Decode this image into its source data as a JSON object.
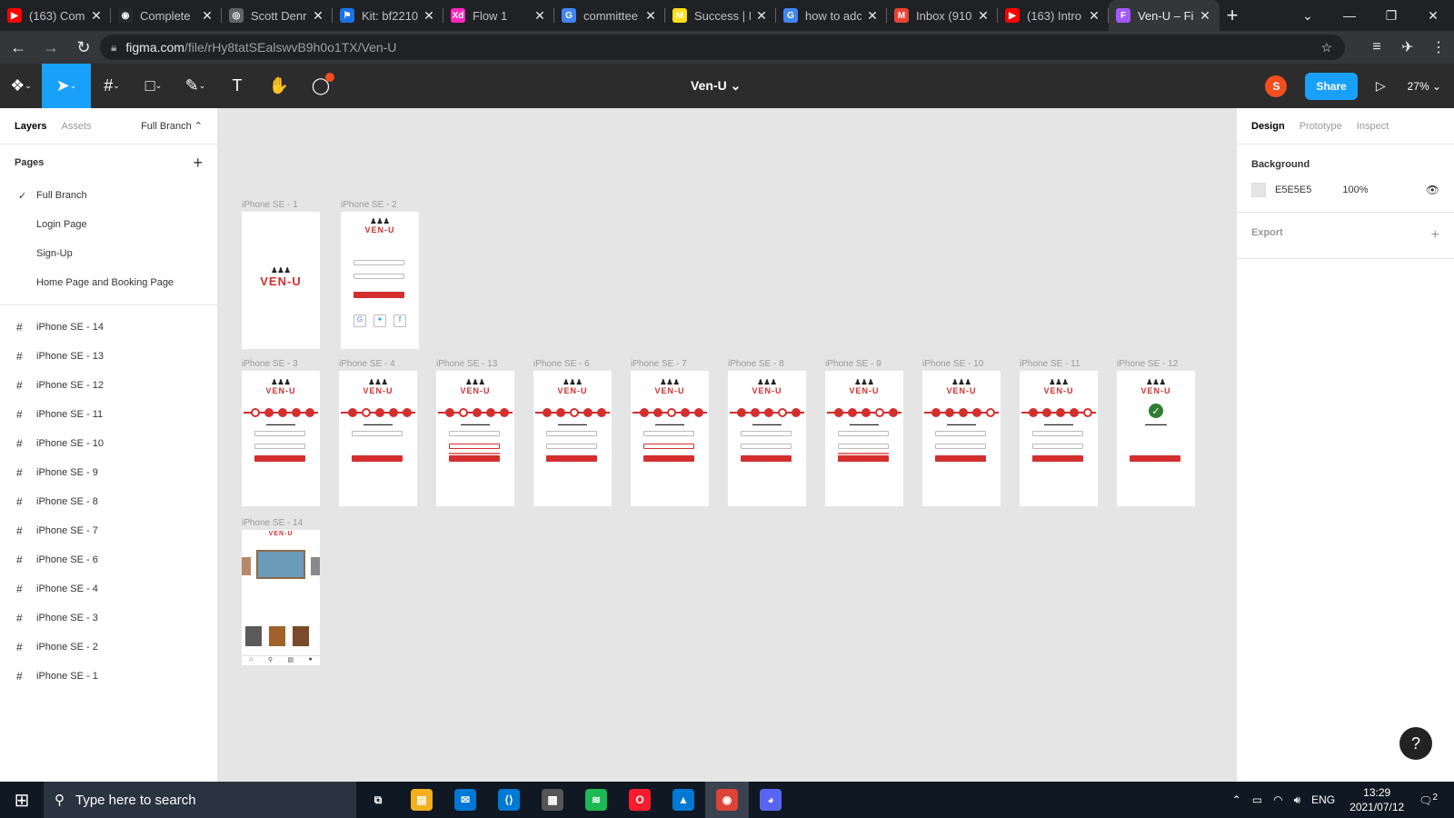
{
  "browser": {
    "tabs": [
      {
        "title": "(163) Com",
        "icon": "youtube-icon",
        "color": "#ff0000",
        "glyph": "▶"
      },
      {
        "title": "Complete",
        "icon": "github-icon",
        "color": "#24292e",
        "glyph": "◉"
      },
      {
        "title": "Scott Denr",
        "icon": "globe-icon",
        "color": "#5f6368",
        "glyph": "◎"
      },
      {
        "title": "Kit: bf2210",
        "icon": "flag-icon",
        "color": "#1a73e8",
        "glyph": "⚑"
      },
      {
        "title": "Flow 1",
        "icon": "xd-icon",
        "color": "#ff26be",
        "glyph": "Xd"
      },
      {
        "title": "committee",
        "icon": "google-icon",
        "color": "#4285f4",
        "glyph": "G"
      },
      {
        "title": "Success | M",
        "icon": "mailchimp-icon",
        "color": "#ffe01b",
        "glyph": "M"
      },
      {
        "title": "how to adc",
        "icon": "google-icon",
        "color": "#4285f4",
        "glyph": "G"
      },
      {
        "title": "Inbox (910",
        "icon": "gmail-icon",
        "color": "#ea4335",
        "glyph": "M"
      },
      {
        "title": "(163) Intro",
        "icon": "youtube-icon",
        "color": "#ff0000",
        "glyph": "▶"
      },
      {
        "title": "Ven-U – Fi",
        "icon": "figma-icon",
        "color": "#a259ff",
        "glyph": "F",
        "active": true
      }
    ],
    "url_host": "figma.com",
    "url_path": "/file/rHy8tatSEalswvB9h0o1TX/Ven-U"
  },
  "figma": {
    "file_title": "Ven-U ⌄",
    "avatar_letter": "S",
    "share_label": "Share",
    "zoom_label": "27% ⌄"
  },
  "left_panel": {
    "tab_layers": "Layers",
    "tab_assets": "Assets",
    "branch_label": "Full Branch ⌃",
    "pages_title": "Pages",
    "pages": [
      "Full Branch",
      "Login Page",
      "Sign-Up",
      "Home Page and Booking Page"
    ],
    "layers": [
      "iPhone SE - 14",
      "iPhone SE - 13",
      "iPhone SE - 12",
      "iPhone SE - 11",
      "iPhone SE - 10",
      "iPhone SE - 9",
      "iPhone SE - 8",
      "iPhone SE - 7",
      "iPhone SE - 6",
      "iPhone SE - 4",
      "iPhone SE - 3",
      "iPhone SE - 2",
      "iPhone SE - 1"
    ]
  },
  "canvas": {
    "logo_text": "VEN-U",
    "frames": [
      {
        "label": "iPhone SE - 1"
      },
      {
        "label": "iPhone SE - 2"
      },
      {
        "label": "iPhone SE - 3"
      },
      {
        "label": "iPhone SE - 4"
      },
      {
        "label": "iPhone SE - 13"
      },
      {
        "label": "iPhone SE - 6"
      },
      {
        "label": "iPhone SE - 7"
      },
      {
        "label": "iPhone SE - 8"
      },
      {
        "label": "iPhone SE - 9"
      },
      {
        "label": "iPhone SE - 10"
      },
      {
        "label": "iPhone SE - 11"
      },
      {
        "label": "iPhone SE - 12"
      },
      {
        "label": "iPhone SE - 14"
      }
    ]
  },
  "right_panel": {
    "tab_design": "Design",
    "tab_prototype": "Prototype",
    "tab_inspect": "Inspect",
    "background_title": "Background",
    "background_hex": "E5E5E5",
    "background_opacity": "100%",
    "background_color": "#e5e5e5",
    "export_title": "Export"
  },
  "help_label": "?",
  "taskbar": {
    "search_placeholder": "Type here to search",
    "apps": [
      {
        "name": "task-view-icon",
        "color": "#101823",
        "glyph": "⧉"
      },
      {
        "name": "file-explorer-icon",
        "color": "#f2b01e",
        "glyph": "▤"
      },
      {
        "name": "mail-icon",
        "color": "#0078d4",
        "glyph": "✉"
      },
      {
        "name": "vscode-icon",
        "color": "#0078d4",
        "glyph": "⟨⟩"
      },
      {
        "name": "store-icon",
        "color": "#555555",
        "glyph": "▦"
      },
      {
        "name": "spotify-icon",
        "color": "#1db954",
        "glyph": "≋"
      },
      {
        "name": "opera-icon",
        "color": "#ff1b2d",
        "glyph": "O"
      },
      {
        "name": "photos-icon",
        "color": "#0078d4",
        "glyph": "▲"
      },
      {
        "name": "chrome-icon",
        "color": "#db4437",
        "glyph": "◉",
        "active": true
      },
      {
        "name": "discord-icon",
        "color": "#5865f2",
        "glyph": "◕"
      }
    ],
    "language": "ENG",
    "time": "13:29",
    "date": "2021/07/12",
    "notifications": "2"
  }
}
